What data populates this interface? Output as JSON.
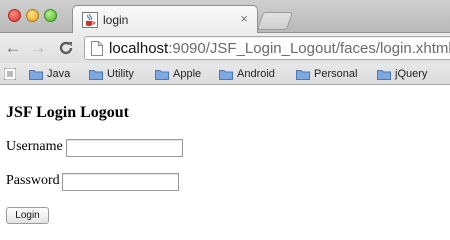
{
  "browser": {
    "tab": {
      "title": "login",
      "close_glyph": "×"
    },
    "address_bar": {
      "host": "localhost",
      "rest": ":9090/JSF_Login_Logout/faces/login.xhtml"
    },
    "nav": {
      "back_glyph": "←",
      "forward_glyph": "→",
      "reload_glyph": "C"
    },
    "bookmarks": [
      {
        "label": "Java"
      },
      {
        "label": "Utility"
      },
      {
        "label": "Apple"
      },
      {
        "label": "Android"
      },
      {
        "label": "Personal"
      },
      {
        "label": "jQuery"
      }
    ],
    "icons": {
      "favicon": "java-coffee-favicon-icon",
      "page": "page-icon",
      "folder": "folder-icon",
      "apps": "apps-icon"
    },
    "colors": {
      "folder": "#5a8fd6",
      "tab_bg": "#f4f4f4",
      "chrome_bg": "#c8c8c8"
    }
  },
  "page": {
    "title": "JSF Login Logout",
    "username_label": "Username",
    "username_value": "",
    "password_label": "Password",
    "password_value": "",
    "login_button": "Login"
  }
}
